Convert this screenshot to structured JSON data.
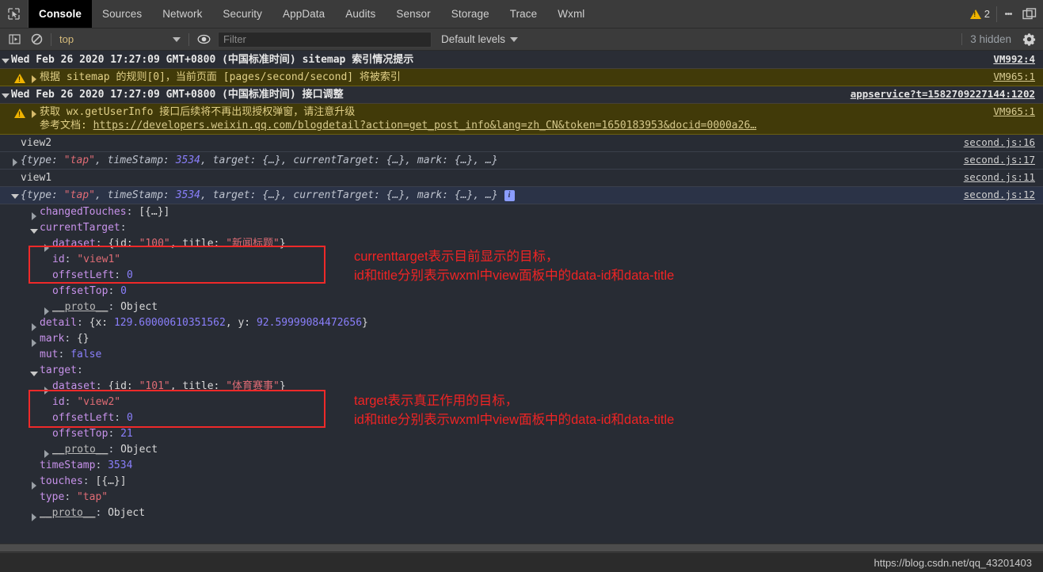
{
  "window": {
    "tabs": [
      {
        "label": "Console",
        "active": true
      },
      {
        "label": "Sources",
        "active": false
      },
      {
        "label": "Network",
        "active": false
      },
      {
        "label": "Security",
        "active": false
      },
      {
        "label": "AppData",
        "active": false
      },
      {
        "label": "Audits",
        "active": false
      },
      {
        "label": "Sensor",
        "active": false
      },
      {
        "label": "Storage",
        "active": false
      },
      {
        "label": "Trace",
        "active": false
      },
      {
        "label": "Wxml",
        "active": false
      }
    ],
    "warning_count": "2",
    "inspect_icon": "inspect-cursor-icon",
    "more_icon": "kebab-menu-icon",
    "dock_icon": "dock-panel-icon"
  },
  "toolbar": {
    "sidebar_icon": "show-console-sidebar-icon",
    "clear_icon": "clear-console-icon",
    "context": "top",
    "eye_icon": "live-expression-icon",
    "filter_placeholder": "Filter",
    "filter_value": "",
    "levels_label": "Default levels",
    "hidden_label": "3 hidden",
    "settings_icon": "gear-icon"
  },
  "console": {
    "groups": [
      {
        "header": "Wed Feb 26 2020 17:27:09 GMT+0800 (中国标准时间) sitemap 索引情况提示",
        "header_src": "VM992:4",
        "warning": "根据 sitemap 的规则[0]，当前页面 [pages/second/second] 将被索引",
        "warning_src": "VM965:1"
      },
      {
        "header": "Wed Feb 26 2020 17:27:09 GMT+0800 (中国标准时间) 接口调整",
        "header_src": "appservice?t=1582709227144:1202",
        "warning": "获取 wx.getUserInfo 接口后续将不再出现授权弹窗，请注意升级",
        "doc_label": "参考文档:",
        "doc_url": "https://developers.weixin.qq.com/blogdetail?action=get_post_info&lang=zh_CN&token=1650183953&docid=0000a26…",
        "warning_src": "VM965:1"
      }
    ],
    "log_view2": {
      "text": "view2",
      "src": "second.js:16"
    },
    "preview_collapsed": {
      "parts": [
        "{type: ",
        "\"tap\"",
        ", timeStamp: ",
        "3534",
        ", target: {…}, currentTarget: {…}, mark: {…}, …}"
      ],
      "src": "second.js:17"
    },
    "log_view1": {
      "text": "view1",
      "src": "second.js:11"
    },
    "preview_expanded": {
      "parts": [
        "{type: ",
        "\"tap\"",
        ", timeStamp: ",
        "3534",
        ", target: {…}, currentTarget: {…}, mark: {…}, …}"
      ],
      "info_badge": "i",
      "src": "second.js:12"
    },
    "tree": [
      {
        "indent": 1,
        "arrow": "right",
        "name": "changedTouches",
        "sep": ": ",
        "value": "[{…}]",
        "vtype": "obj"
      },
      {
        "indent": 1,
        "arrow": "down",
        "name": "currentTarget",
        "sep": ":",
        "value": "",
        "vtype": "none"
      },
      {
        "indent": 2,
        "arrow": "right",
        "name": "dataset",
        "sep": ": ",
        "value": "{id: \"100\", title: \"新闻标题\"}",
        "vtype": "dataset",
        "id_val": "\"100\"",
        "title_val": "\"新闻标题\""
      },
      {
        "indent": 2,
        "arrow": "none",
        "name": "id",
        "sep": ": ",
        "value": "\"view1\"",
        "vtype": "str"
      },
      {
        "indent": 2,
        "arrow": "none",
        "name": "offsetLeft",
        "sep": ": ",
        "value": "0",
        "vtype": "num"
      },
      {
        "indent": 2,
        "arrow": "none",
        "name": "offsetTop",
        "sep": ": ",
        "value": "0",
        "vtype": "num"
      },
      {
        "indent": 2,
        "arrow": "right",
        "name": "__proto__",
        "sep": ": ",
        "value": "Object",
        "vtype": "proto"
      },
      {
        "indent": 1,
        "arrow": "right",
        "name": "detail",
        "sep": ": ",
        "value": "{x: 129.60000610351562, y: 92.59999084472656}",
        "vtype": "detail",
        "x_val": "129.60000610351562",
        "y_val": "92.59999084472656"
      },
      {
        "indent": 1,
        "arrow": "right",
        "name": "mark",
        "sep": ": ",
        "value": "{}",
        "vtype": "obj"
      },
      {
        "indent": 1,
        "arrow": "none",
        "name": "mut",
        "sep": ": ",
        "value": "false",
        "vtype": "num"
      },
      {
        "indent": 1,
        "arrow": "down",
        "name": "target",
        "sep": ":",
        "value": "",
        "vtype": "none"
      },
      {
        "indent": 2,
        "arrow": "right",
        "name": "dataset",
        "sep": ": ",
        "value": "{id: \"101\", title: \"体育赛事\"}",
        "vtype": "dataset",
        "id_val": "\"101\"",
        "title_val": "\"体育赛事\""
      },
      {
        "indent": 2,
        "arrow": "none",
        "name": "id",
        "sep": ": ",
        "value": "\"view2\"",
        "vtype": "str"
      },
      {
        "indent": 2,
        "arrow": "none",
        "name": "offsetLeft",
        "sep": ": ",
        "value": "0",
        "vtype": "num"
      },
      {
        "indent": 2,
        "arrow": "none",
        "name": "offsetTop",
        "sep": ": ",
        "value": "21",
        "vtype": "num"
      },
      {
        "indent": 2,
        "arrow": "right",
        "name": "__proto__",
        "sep": ": ",
        "value": "Object",
        "vtype": "proto"
      },
      {
        "indent": 1,
        "arrow": "none",
        "name": "timeStamp",
        "sep": ": ",
        "value": "3534",
        "vtype": "num"
      },
      {
        "indent": 1,
        "arrow": "right",
        "name": "touches",
        "sep": ": ",
        "value": "[{…}]",
        "vtype": "obj"
      },
      {
        "indent": 1,
        "arrow": "none",
        "name": "type",
        "sep": ": ",
        "value": "\"tap\"",
        "vtype": "str"
      },
      {
        "indent": 1,
        "arrow": "right",
        "name": "__proto__",
        "sep": ": ",
        "value": "Object",
        "vtype": "proto"
      }
    ]
  },
  "annotations": [
    {
      "id": "currenttarget-note",
      "line1": "currenttarget表示目前显示的目标，",
      "line2": "id和title分别表示wxml中view面板中的data-id和data-title"
    },
    {
      "id": "target-note",
      "line1": "target表示真正作用的目标，",
      "line2": "id和title分别表示wxml中view面板中的data-id和data-title"
    }
  ],
  "status": {
    "url": "https://blog.csdn.net/qq_43201403"
  },
  "colors": {
    "accent_red": "#ef2424",
    "warn_bg": "#413a09",
    "warn_icon": "#f0b400",
    "string": "#e06c75",
    "number": "#8a7ffb",
    "property": "#c792ea",
    "selected_row": "#2b3347"
  }
}
